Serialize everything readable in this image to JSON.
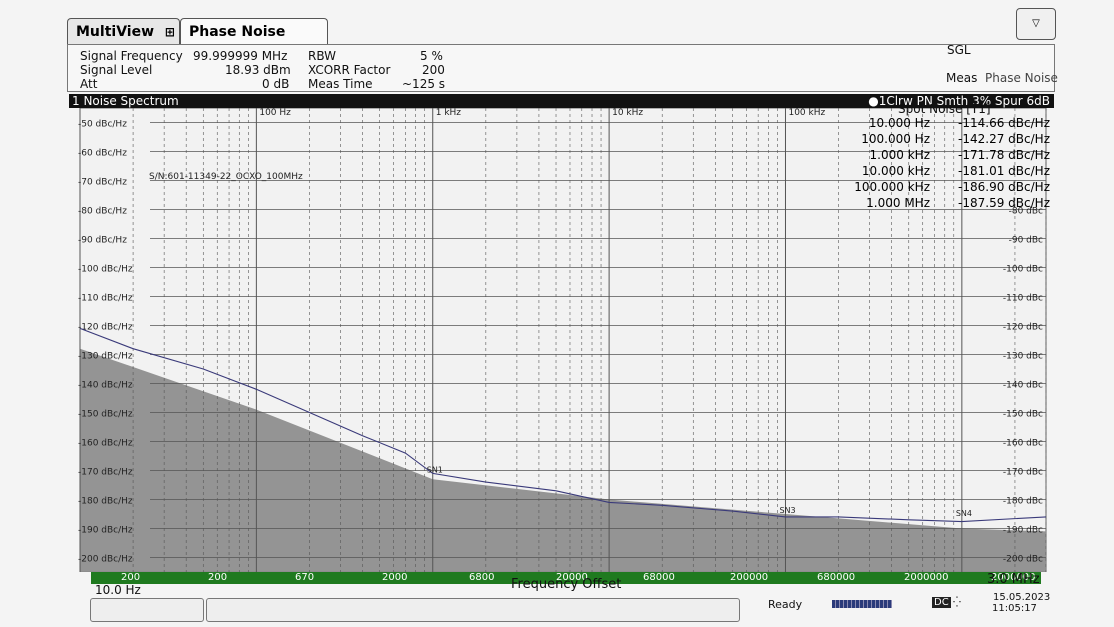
{
  "tabs": {
    "multiview": "MultiView",
    "phase_noise": "Phase Noise"
  },
  "header": {
    "signal_frequency_label": "Signal Frequency",
    "signal_frequency_value": "99.999999 MHz",
    "signal_level_label": "Signal Level",
    "signal_level_value": "18.93 dBm",
    "att_label": "Att",
    "att_value": "0 dB",
    "rbw_label": "RBW",
    "rbw_value": "5 %",
    "xcorr_label": "XCORR Factor",
    "xcorr_value": "200",
    "meas_time_label": "Meas Time",
    "meas_time_value": "~125 s",
    "sgl": "SGL",
    "meas_label": "Meas",
    "meas_value": "Phase Noise"
  },
  "plot": {
    "title": "1 Noise Spectrum",
    "trace_info": "●1Clrw PN Smth 3% Spur 6dB",
    "annotation": "S/N:601-11349-22_OCXO_100MHz",
    "decade_labels": [
      "100 Hz",
      "1 kHz",
      "10 kHz",
      "100 kHz"
    ],
    "markers": [
      "SN1",
      "SN3",
      "SN4"
    ],
    "spot_noise_title": "Spot Noise [T1]",
    "spot_noise": [
      {
        "freq": "10.000 Hz",
        "val": "-114.66 dBc/Hz"
      },
      {
        "freq": "100.000 Hz",
        "val": "-142.27 dBc/Hz"
      },
      {
        "freq": "1.000 kHz",
        "val": "-171.78 dBc/Hz"
      },
      {
        "freq": "10.000 kHz",
        "val": "-181.01 dBc/Hz"
      },
      {
        "freq": "100.000 kHz",
        "val": "-186.90 dBc/Hz"
      },
      {
        "freq": "1.000 MHz",
        "val": "-187.59 dBc/Hz"
      }
    ]
  },
  "chart_data": {
    "type": "line",
    "title": "1 Noise Spectrum",
    "xlabel": "Frequency Offset",
    "x_scale": "log",
    "xlim": [
      10,
      3000000
    ],
    "ylim": [
      -205,
      -45
    ],
    "y_ticks_left": [
      "-50 dBc/Hz",
      "-60 dBc/Hz",
      "-70 dBc/Hz",
      "-80 dBc/Hz",
      "-90 dBc/Hz",
      "-100 dBc/Hz",
      "-110 dBc/Hz",
      "-120 dBc/Hz",
      "-130 dBc/Hz",
      "-140 dBc/Hz",
      "-150 dBc/Hz",
      "-160 dBc/Hz",
      "-170 dBc/Hz",
      "-180 dBc/Hz",
      "-190 dBc/Hz",
      "-200 dBc/Hz"
    ],
    "y_ticks_right": [
      "-80 dBc",
      "-90 dBc",
      "-100 dBc",
      "-110 dBc",
      "-120 dBc",
      "-130 dBc",
      "-140 dBc",
      "-150 dBc",
      "-160 dBc",
      "-170 dBc",
      "-180 dBc",
      "-190 dBc",
      "-200 dBc"
    ],
    "series": [
      {
        "values_x": [
          10,
          20,
          50,
          100,
          200,
          400,
          700,
          1000,
          2000,
          5000,
          10000,
          20000,
          50000,
          100000,
          200000,
          500000,
          1000000,
          3000000
        ],
        "values_y": [
          -121,
          -128,
          -135,
          -142,
          -150,
          -158,
          -164,
          -171,
          -174,
          -177,
          -181,
          -182,
          -184,
          -186,
          -186,
          -187,
          -187.6,
          -186
        ]
      }
    ],
    "floor": {
      "values_x": [
        10,
        100,
        1000,
        10000,
        100000,
        1000000,
        3000000
      ],
      "values_y": [
        -128,
        -149,
        -173,
        -180,
        -185,
        -190,
        -191
      ]
    },
    "bottom_bar_labels": [
      "200",
      "200",
      "670",
      "2000",
      "6800",
      "20000",
      "68000",
      "200000",
      "680000",
      "2000000",
      "2000000"
    ],
    "start_label": "10.0 Hz",
    "stop_label": "3.0 MHz"
  },
  "status": {
    "ready": "Ready",
    "dc": "DC",
    "date": "15.05.2023",
    "time": "11:05:17"
  },
  "colors": {
    "trace": "#3a3a7a",
    "floor": "#8a8a8a",
    "freqbar": "#1f7a1f",
    "grid": "#555555"
  }
}
